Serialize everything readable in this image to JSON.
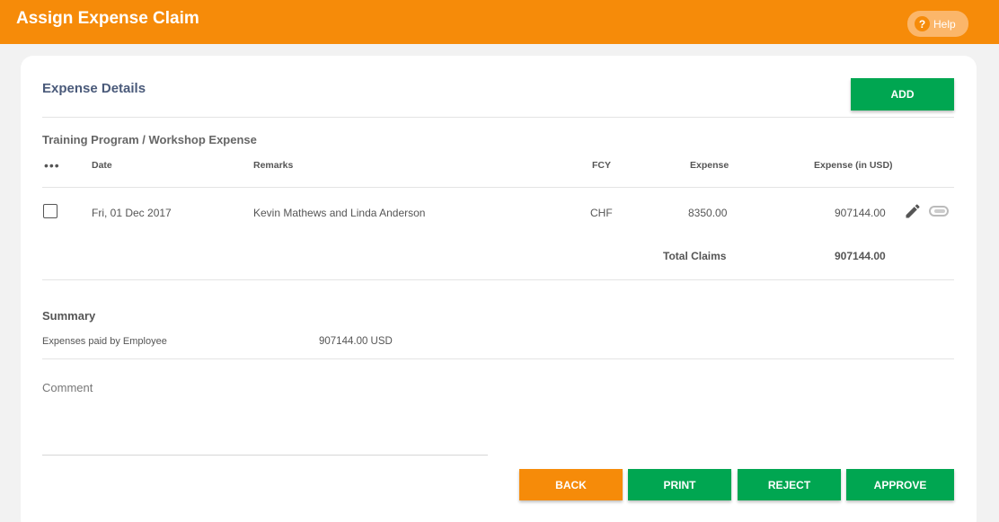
{
  "header": {
    "title": "Assign Expense Claim",
    "help_label": "Help",
    "help_icon_glyph": "?"
  },
  "section": {
    "title": "Expense Details",
    "add_label": "ADD"
  },
  "category": "Training Program / Workshop Expense",
  "table": {
    "columns": {
      "menu": "•••",
      "date": "Date",
      "remarks": "Remarks",
      "fcy": "FCY",
      "expense": "Expense",
      "expense_usd": "Expense (in USD)"
    },
    "rows": [
      {
        "date": "Fri, 01 Dec 2017",
        "remarks": "Kevin Mathews and Linda Anderson",
        "fcy": "CHF",
        "expense": "8350.00",
        "expense_usd": "907144.00",
        "checked": false
      }
    ],
    "total_label": "Total Claims",
    "total_value": "907144.00"
  },
  "summary": {
    "title": "Summary",
    "label": "Expenses paid by Employee",
    "value": "907144.00 USD"
  },
  "comment": {
    "label": "Comment",
    "value": ""
  },
  "actions": {
    "back": "BACK",
    "print": "PRINT",
    "reject": "REJECT",
    "approve": "APPROVE"
  },
  "colors": {
    "brand": "#f68b09",
    "success": "#00a651",
    "help_bg": "#fbb66a"
  },
  "icons": {
    "row_edit": "pencil-icon",
    "row_attach": "attachment-icon",
    "help": "question-circle-icon"
  }
}
